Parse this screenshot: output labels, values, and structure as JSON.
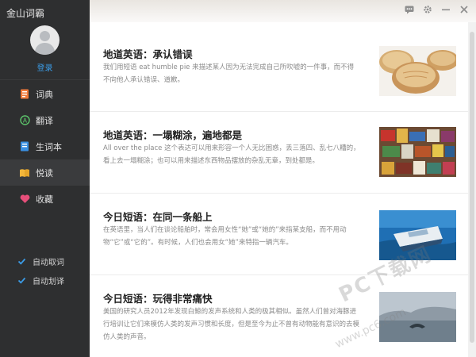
{
  "app": {
    "title": "金山词霸"
  },
  "user": {
    "login_label": "登录"
  },
  "nav": [
    {
      "label": "词典",
      "icon": "dictionary-icon",
      "active": false
    },
    {
      "label": "翻译",
      "icon": "translate-icon",
      "active": false
    },
    {
      "label": "生词本",
      "icon": "wordbook-icon",
      "active": false
    },
    {
      "label": "悦读",
      "icon": "reading-icon",
      "active": true
    },
    {
      "label": "收藏",
      "icon": "heart-icon",
      "active": false
    }
  ],
  "options": [
    {
      "label": "自动取词",
      "checked": true
    },
    {
      "label": "自动划译",
      "checked": true
    }
  ],
  "articles": [
    {
      "title": "地道英语：承认错误",
      "text": "我们用短语 eat humble pie 来描述某人因为无法完成自己所吹嘘的一件事，而不得不向他人承认错误、道歉。",
      "image": "pie-photo"
    },
    {
      "title": "地道英语：一塌糊涂，遍地都是",
      "text": "All over the place 这个表达可以用来形容一个人无比困惑，丢三落四、乱七八糟的，看上去一塌糊涂；也可以用来描述东西物品摆放的杂乱无章，到处都是。",
      "image": "market-photo"
    },
    {
      "title": "今日短语：在同一条船上",
      "text": "在英语里，当人们在谈论船舶时，常会用女性“她”或“她的”来指某支船，而不用动物“它”或“它的”。有时候，人们也会用女“她”来特指一辆汽车。",
      "image": "boat-photo"
    },
    {
      "title": "今日短语：玩得非常痛快",
      "text": "美国的研究人员2012年发现白鲸的发声系统和人类的极其相似。虽然人们曾对海豚进行培训让它们来模仿人类的发声习惯和长度，但是至今为止不曾有动物能有意识的去模仿人类的声音。",
      "image": "whale-photo"
    }
  ],
  "watermark": {
    "text": "PC下载网",
    "url": "www.pc6.com"
  },
  "colors": {
    "sidebar": "#2e2f30",
    "accent_blue": "#3b9de8",
    "heart": "#e64f7a"
  }
}
